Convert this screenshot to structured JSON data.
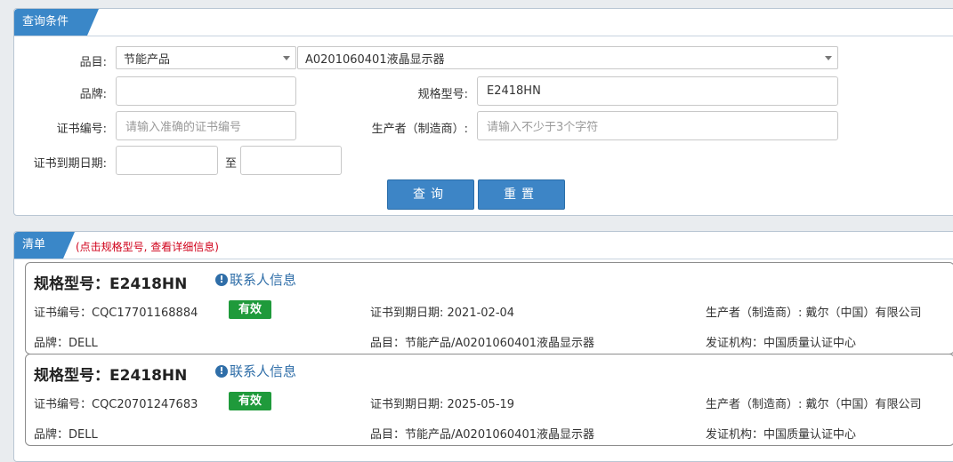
{
  "search_panel": {
    "tab_label": "查询条件",
    "category_label": "品目:",
    "category_value": "节能产品",
    "subcategory_value": "A0201060401液晶显示器",
    "brand_label": "品牌:",
    "brand_value": "",
    "model_label": "规格型号:",
    "model_value": "E2418HN",
    "cert_no_label": "证书编号:",
    "cert_no_placeholder": "请输入准确的证书编号",
    "maker_label": "生产者（制造商）:",
    "maker_placeholder": "请输入不少于3个字符",
    "expiry_label": "证书到期日期:",
    "expiry_to": "至",
    "query_button": "查询",
    "reset_button": "重置"
  },
  "results_panel": {
    "tab_label": "清单",
    "hint": "(点击规格型号, 查看详细信息)",
    "items": [
      {
        "title": "规格型号：E2418HN",
        "contact": "联系人信息",
        "cert_no": "证书编号：CQC17701168884",
        "status": "有效",
        "expiry": "证书到期日期: 2021-02-04",
        "maker": "生产者（制造商）: 戴尔（中国）有限公司",
        "brand": "品牌：DELL",
        "category": "品目：节能产品/A0201060401液晶显示器",
        "issuer": "发证机构：中国质量认证中心"
      },
      {
        "title": "规格型号：E2418HN",
        "contact": "联系人信息",
        "cert_no": "证书编号：CQC20701247683",
        "status": "有效",
        "expiry": "证书到期日期: 2025-05-19",
        "maker": "生产者（制造商）: 戴尔（中国）有限公司",
        "brand": "品牌：DELL",
        "category": "品目：节能产品/A0201060401液晶显示器",
        "issuer": "发证机构：中国质量认证中心"
      }
    ]
  },
  "colors": {
    "accent": "#3a87c8",
    "valid_badge": "#1f9a3b",
    "hint_red": "#d0021b",
    "link_blue": "#2f6ea8"
  }
}
